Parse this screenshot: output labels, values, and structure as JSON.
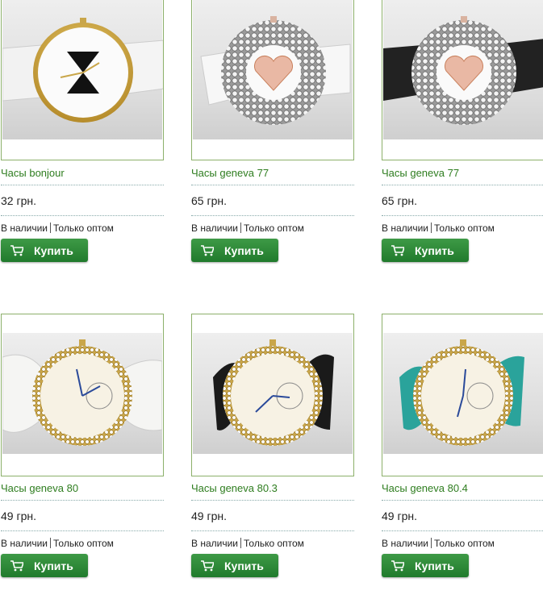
{
  "colors": {
    "accent": "#2e7d1f",
    "button": "#2a8a36",
    "border": "#8cb06a"
  },
  "products": [
    {
      "title": "Часы bonjour",
      "price": "32 грн.",
      "status": "В наличии",
      "wholesale": "Только оптом",
      "buy": "Купить",
      "icon": "cart-icon"
    },
    {
      "title": "Часы geneva 77",
      "price": "65 грн.",
      "status": "В наличии",
      "wholesale": "Только оптом",
      "buy": "Купить",
      "icon": "cart-icon"
    },
    {
      "title": "Часы geneva 77",
      "price": "65 грн.",
      "status": "В наличии",
      "wholesale": "Только оптом",
      "buy": "Купить",
      "icon": "cart-icon"
    },
    {
      "title": "Часы geneva 80",
      "price": "49 грн.",
      "status": "В наличии",
      "wholesale": "Только оптом",
      "buy": "Купить",
      "icon": "cart-icon"
    },
    {
      "title": "Часы geneva 80.3",
      "price": "49 грн.",
      "status": "В наличии",
      "wholesale": "Только оптом",
      "buy": "Купить",
      "icon": "cart-icon"
    },
    {
      "title": "Часы geneva 80.4",
      "price": "49 грн.",
      "status": "В наличии",
      "wholesale": "Только оптом",
      "buy": "Купить",
      "icon": "cart-icon"
    }
  ]
}
